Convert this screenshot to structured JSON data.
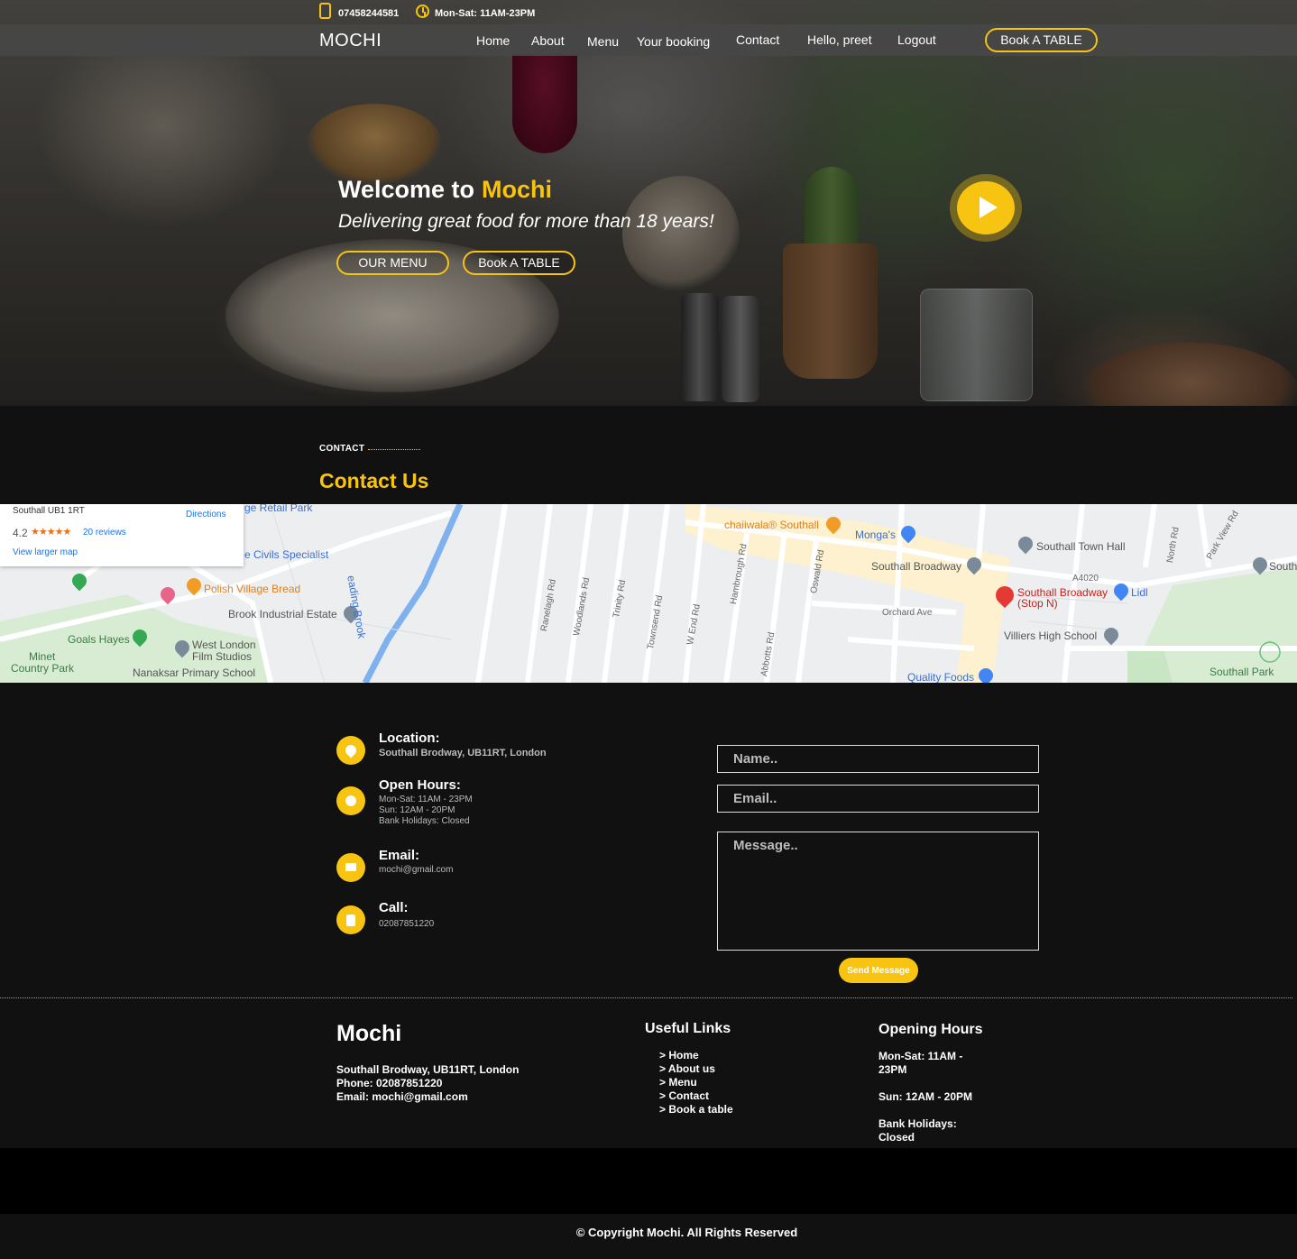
{
  "topbar": {
    "phone": "07458244581",
    "hours": "Mon-Sat: 11AM-23PM"
  },
  "nav": {
    "brand": "MOCHI",
    "links": [
      "Home",
      "About",
      "Menu",
      "Your booking",
      "Contact",
      "Hello, preet",
      "Logout"
    ],
    "cta": "Book A TABLE"
  },
  "hero": {
    "welcome": "Welcome to",
    "brand": "Mochi",
    "tagline": "Delivering great food for more than 18 years!",
    "menu_button": "OUR MENU",
    "book_button": "Book A TABLE"
  },
  "contact": {
    "eyebrow": "CONTACT",
    "title": "Contact Us"
  },
  "map": {
    "card": {
      "address": "Southall UB1 1RT",
      "directions": "Directions",
      "rating": "4.2",
      "stars": "★★★★★",
      "reviews": "20 reviews",
      "larger": "View larger map"
    },
    "labels": {
      "retail": "ge Retail Park",
      "civils": "e Civils Specialist",
      "polish": "Polish Village Bread",
      "brook_ind": "Brook Industrial Estate",
      "goals": "Goals Hayes",
      "west_london": "West London",
      "film": "Film Studios",
      "minet": "Minet",
      "country_park": "Country Park",
      "nanaksar": "Nanaksar Primary School",
      "chaiiwala": "chaiiwala® Southall",
      "mongas": "Monga's",
      "town_hall": "Southall Town Hall",
      "broadway": "Southall Broadway",
      "a4020": "A4020",
      "stop_n1": "Southall Broadway",
      "stop_n2": "(Stop N)",
      "lidl": "Lidl",
      "orchard": "Orchard Ave",
      "villiers": "Villiers High School",
      "quality": "Quality Foods",
      "south_park": "Southall Park",
      "south_edge": "South",
      "reading": "eading Brook",
      "ranelagh": "Ranelagh Rd",
      "woodlands": "Woodlands Rd",
      "trinity": "Trinity Rd",
      "townsend": "Townsend Rd",
      "westend": "W End Rd",
      "hambrough": "Hambrough Rd",
      "abbotts": "Abbotts Rd",
      "oswald": "Oswald Rd",
      "north": "North Rd",
      "parkview": "Park View Rd"
    }
  },
  "info": {
    "location_title": "Location:",
    "location_text": "Southall Brodway, UB11RT, London",
    "hours_title": "Open Hours:",
    "hours_lines": [
      "Mon-Sat: 11AM - 23PM",
      "Sun: 12AM - 20PM",
      "Bank Holidays: Closed"
    ],
    "email_title": "Email:",
    "email_text": "mochi@gmail.com",
    "call_title": "Call:",
    "call_text": "02087851220"
  },
  "form": {
    "name_placeholder": "Name..",
    "email_placeholder": "Email..",
    "message_placeholder": "Message..",
    "send": "Send Message"
  },
  "footer": {
    "brand": "Mochi",
    "address": "Southall Brodway, UB11RT, London",
    "phone": "Phone: 02087851220",
    "email": "Email: mochi@gmail.com",
    "links_title": "Useful Links",
    "links": [
      "> Home",
      "> About us",
      "> Menu",
      "> Contact",
      "> Book a table"
    ],
    "hours_title": "Opening Hours",
    "hours": [
      "Mon-Sat: 11AM - 23PM",
      "Sun: 12AM - 20PM",
      "Bank Holidays: Closed"
    ]
  },
  "copyright": "© Copyright Mochi. All Rights Reserved",
  "colors": {
    "accent": "#f7c411",
    "background": "#111111",
    "nav": "#464646"
  }
}
